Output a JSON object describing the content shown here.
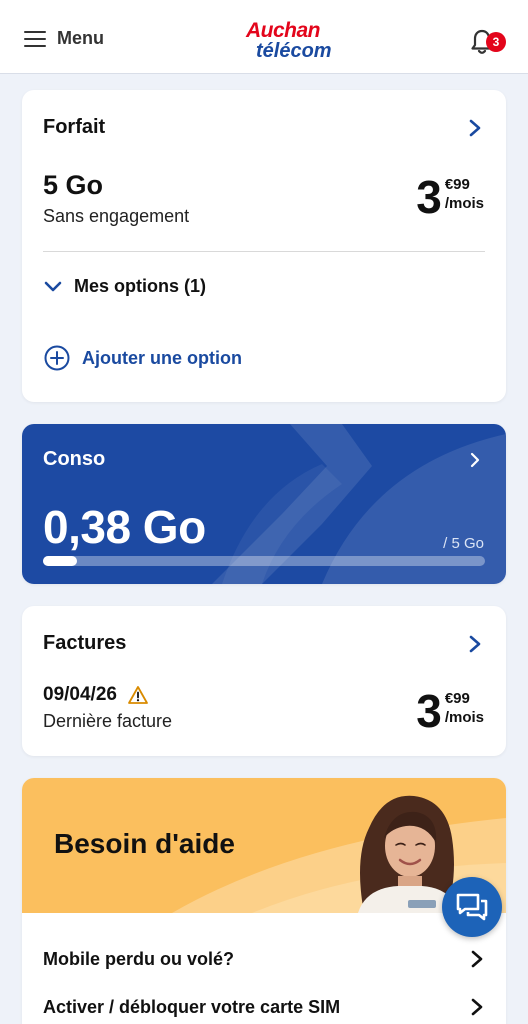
{
  "header": {
    "menu_label": "Menu",
    "logo_top": "Auchan",
    "logo_bottom": "télécom",
    "notification_count": "3"
  },
  "forfait": {
    "title": "Forfait",
    "plan_name": "5 Go",
    "plan_sub": "Sans engagement",
    "price_int": "3",
    "price_cents": "€99",
    "price_unit": "/mois",
    "options_label": "Mes options (1)",
    "add_option_label": "Ajouter une option"
  },
  "conso": {
    "title": "Conso",
    "used": "0,38 Go",
    "max": "/ 5 Go",
    "progress_fraction": 0.076
  },
  "factures": {
    "title": "Factures",
    "date": "09/04/26",
    "sub": "Dernière facture",
    "price_int": "3",
    "price_cents": "€99",
    "price_unit": "/mois"
  },
  "aide": {
    "title": "Besoin d'aide",
    "items": [
      {
        "label": "Mobile perdu ou volé?"
      },
      {
        "label": "Activer / débloquer votre carte SIM"
      }
    ]
  },
  "colors": {
    "brand_blue": "#1d4aa3",
    "brand_red": "#e3051b",
    "banner_yellow": "#fbbf5e",
    "warning": "#d98b00"
  }
}
